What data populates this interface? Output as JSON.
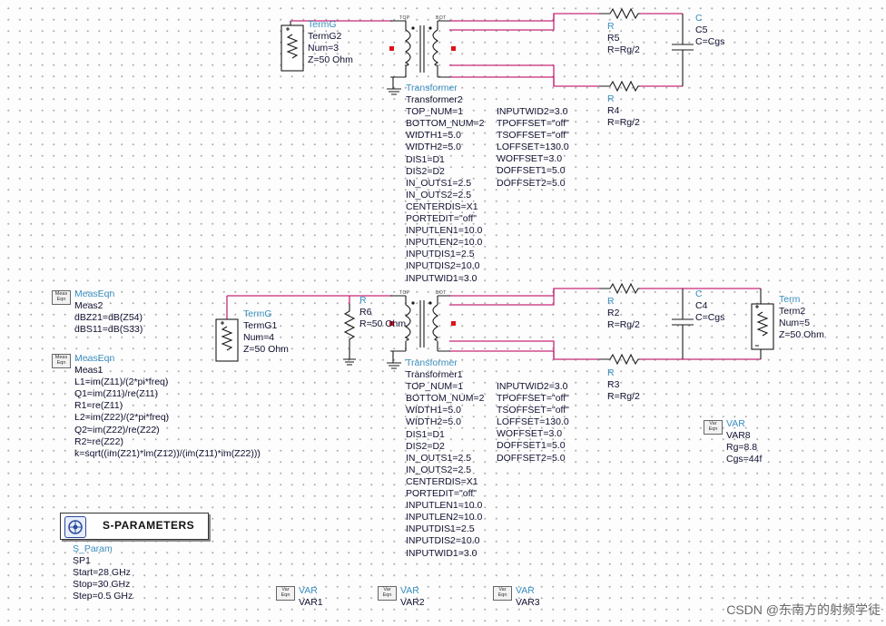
{
  "transformer2": {
    "type_label": "Transformer",
    "name": "Transformer2",
    "top_label": "TOP",
    "bot_label": "BOT",
    "params_left": [
      "TOP_NUM=1",
      "BOTTOM_NUM=2",
      "WIDTH1=5.0",
      "WIDTH2=5.0",
      "DIS1=D1",
      "DIS2=D2",
      "IN_OUTS1=2.5",
      "IN_OUTS2=2.5",
      "CENTERDIS=X1",
      "PORTEDIT=\"off\"",
      "INPUTLEN1=10.0",
      "INPUTLEN2=10.0",
      "INPUTDIS1=2.5",
      "INPUTDIS2=10.0",
      "INPUTWID1=3.0"
    ],
    "params_right": [
      "INPUTWID2=3.0",
      "TPOFFSET=\"off\"",
      "TSOFFSET=\"off\"",
      "LOFFSET=130.0",
      "WOFFSET=3.0",
      "DOFFSET1=5.0",
      "DOFFSET2=5.0"
    ]
  },
  "transformer1": {
    "type_label": "Transformer",
    "name": "Transformer1",
    "top_label": "TOP",
    "bot_label": "BOT",
    "params_left": [
      "TOP_NUM=1",
      "BOTTOM_NUM=2",
      "WIDTH1=5.0",
      "WIDTH2=5.0",
      "DIS1=D1",
      "DIS2=D2",
      "IN_OUTS1=2.5",
      "IN_OUTS2=2.5",
      "CENTERDIS=X1",
      "PORTEDIT=\"off\"",
      "INPUTLEN1=10.0",
      "INPUTLEN2=10.0",
      "INPUTDIS1=2.5",
      "INPUTDIS2=10.0",
      "INPUTWID1=3.0"
    ],
    "params_right": [
      "INPUTWID2=3.0",
      "TPOFFSET=\"off\"",
      "TSOFFSET=\"off\"",
      "LOFFSET=130.0",
      "WOFFSET=3.0",
      "DOFFSET1=5.0",
      "DOFFSET2=5.0"
    ]
  },
  "termg2": {
    "type_label": "TermG",
    "lines": [
      "TermG2",
      "Num=3",
      "Z=50 Ohm"
    ]
  },
  "termg1": {
    "type_label": "TermG",
    "lines": [
      "TermG1",
      "Num=4",
      "Z=50 Ohm"
    ]
  },
  "term2": {
    "type_label": "Term",
    "lines": [
      "Term2",
      "Num=5",
      "Z=50 Ohm"
    ]
  },
  "r5": {
    "type_label": "R",
    "lines": [
      "R5",
      "R=Rg/2"
    ]
  },
  "r4": {
    "type_label": "R",
    "lines": [
      "R4",
      "R=Rg/2"
    ]
  },
  "r2": {
    "type_label": "R",
    "lines": [
      "R2",
      "R=Rg/2"
    ]
  },
  "r3": {
    "type_label": "R",
    "lines": [
      "R3",
      "R=Rg/2"
    ]
  },
  "r6": {
    "type_label": "R",
    "lines": [
      "R6",
      "R=50 Ohm"
    ]
  },
  "c5": {
    "type_label": "C",
    "lines": [
      "C5",
      "C=Cgs"
    ]
  },
  "c4": {
    "type_label": "C",
    "lines": [
      "C4",
      "C=Cgs"
    ]
  },
  "meas2": {
    "icon": "Meas Eqn",
    "type_label": "MeasEqn",
    "lines": [
      "Meas2",
      "dBZ21=dB(Z54)",
      "dBS11=dB(S33)"
    ]
  },
  "meas1": {
    "icon": "Meas Eqn",
    "type_label": "MeasEqn",
    "lines": [
      "Meas1",
      "L1=im(Z11)/(2*pi*freq)",
      "Q1=im(Z11)/re(Z11)",
      "R1=re(Z11)",
      "L2=im(Z22)/(2*pi*freq)",
      "Q2=im(Z22)/re(Z22)",
      "R2=re(Z22)",
      "k=sqrt((im(Z21)*im(Z12))/(im(Z11)*im(Z22)))"
    ]
  },
  "sparams": {
    "title": "S-PARAMETERS",
    "type_label": "S_Param",
    "lines": [
      "SP1",
      "Start=28 GHz",
      "Stop=30 GHz",
      "Step=0.5 GHz"
    ]
  },
  "var8": {
    "icon": "Var Eqn",
    "type_label": "VAR",
    "lines": [
      "VAR8",
      "Rg=8.8",
      "Cgs=44f"
    ]
  },
  "var1": {
    "icon": "Var Eqn",
    "type_label": "VAR",
    "lines": [
      "VAR1"
    ]
  },
  "var2": {
    "icon": "Var Eqn",
    "type_label": "VAR",
    "lines": [
      "VAR2"
    ]
  },
  "var3": {
    "icon": "Var Eqn",
    "type_label": "VAR",
    "lines": [
      "VAR3"
    ]
  },
  "watermark": "CSDN @东南方的射频学徒",
  "colors": {
    "wire": "#c8287a",
    "component": "#1a1a1a",
    "type_label": "#3a8fc0",
    "text": "#101030"
  }
}
